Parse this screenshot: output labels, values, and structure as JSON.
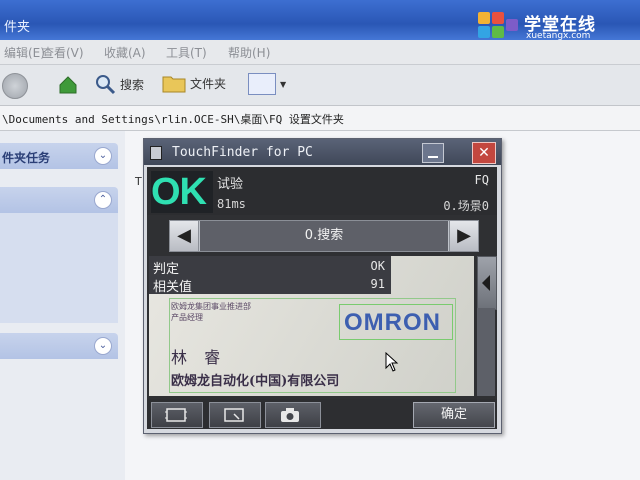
{
  "explorer": {
    "title_fragment": "件夹",
    "menu": [
      "编辑(E)",
      "查看(V)",
      "收藏(A)",
      "工具(T)",
      "帮助(H)"
    ],
    "toolbar": {
      "search_label": "搜索",
      "folders_label": "文件夹"
    },
    "address": "\\Documents and Settings\\rlin.OCE-SH\\桌面\\FQ 设置文件夹",
    "taskpane": {
      "section1_title": "件夹任务",
      "right_text_fragment": "T"
    }
  },
  "logo": {
    "brand": "学堂在线",
    "url": "xuetangx.com"
  },
  "touchfinder": {
    "title": "TouchFinder for PC",
    "status": {
      "result": "OK",
      "scene_label": "试验",
      "time": "81ms",
      "model": "FQ",
      "scene": "0.场景0"
    },
    "nav": {
      "label": "0.搜索"
    },
    "results": [
      {
        "key": "判定",
        "value": "OK"
      },
      {
        "key": "相关值",
        "value": "91"
      }
    ],
    "image": {
      "small_line1": "欧姆龙集团事业推进部",
      "small_line2": "产品经理",
      "name": "林 睿",
      "company": "欧姆龙自动化(中国)有限公司",
      "logo_text": "OMRON"
    },
    "buttons": {
      "confirm": "确定"
    }
  },
  "colors": {
    "ok_green": "#2fe0b2",
    "title_bar": "#3f4758",
    "close_red": "#c3473f"
  }
}
